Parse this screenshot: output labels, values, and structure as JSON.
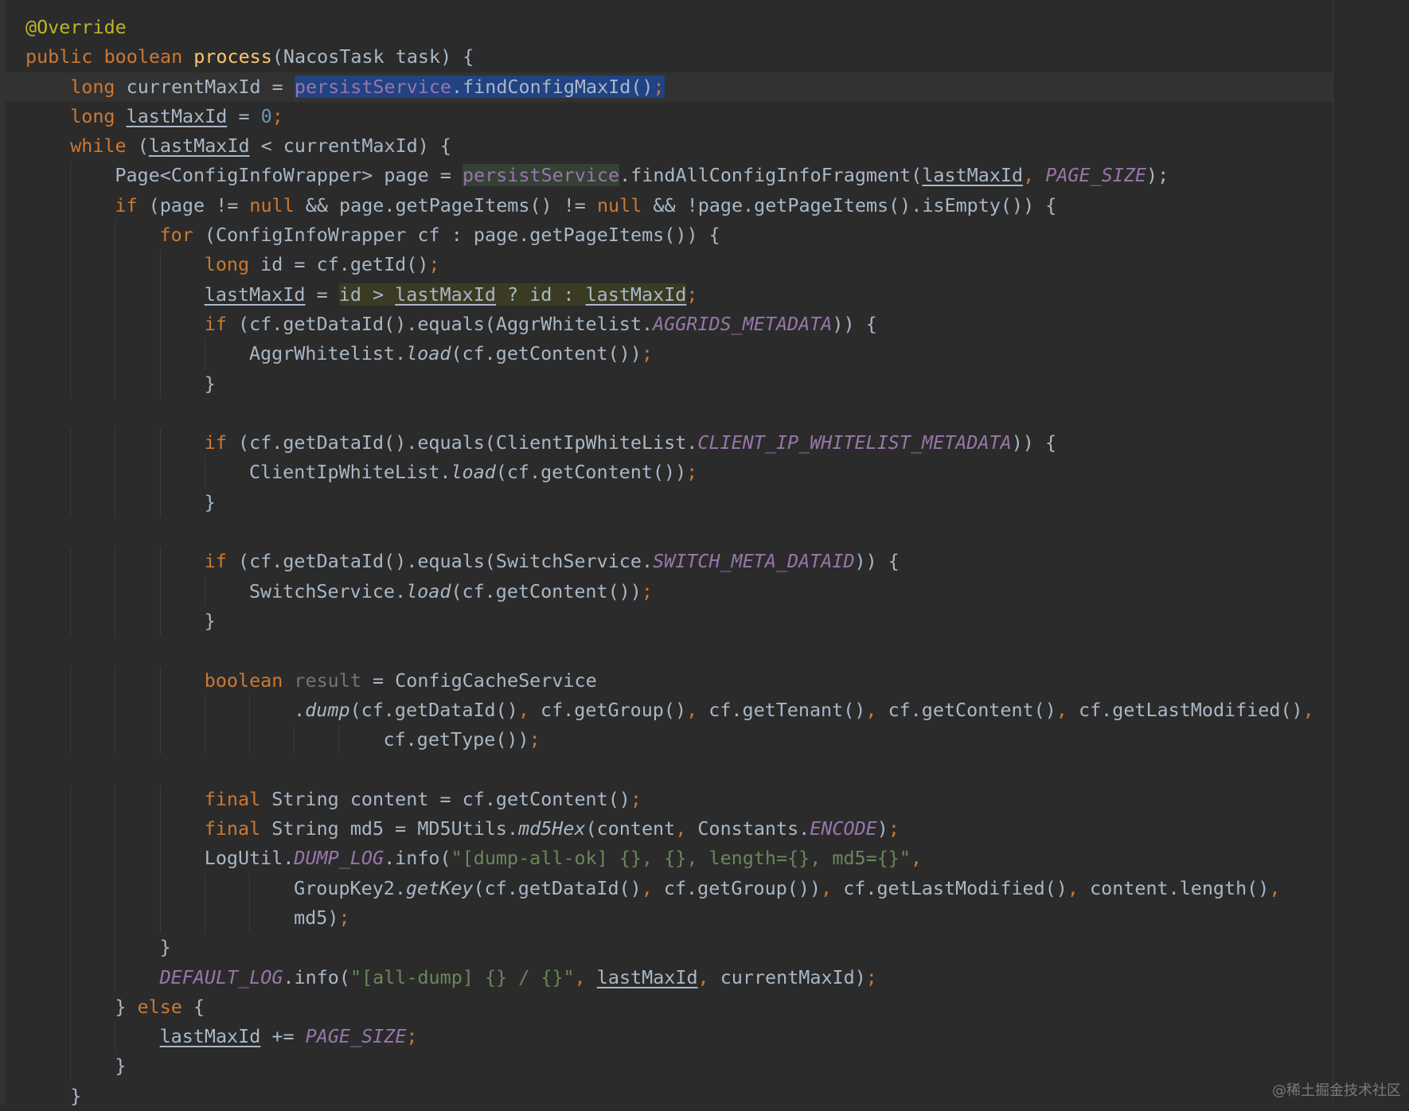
{
  "editor": {
    "colors": {
      "background": "#2b2b2b",
      "keyword": "#cc7832",
      "annotation": "#bbb529",
      "method_declaration": "#ffc66d",
      "number": "#6897bb",
      "string": "#6a8759",
      "constant": "#9876aa",
      "selection": "#214283",
      "default_text": "#a9b7c6"
    },
    "lines": [
      [
        {
          "t": "@Override",
          "c": "ann"
        }
      ],
      [
        {
          "t": "public ",
          "c": "kw"
        },
        {
          "t": "boolean ",
          "c": "kw"
        },
        {
          "t": "process",
          "c": "fn"
        },
        {
          "t": "(NacosTask task) {"
        }
      ],
      [
        {
          "t": "long ",
          "c": "kw"
        },
        {
          "t": "currentMaxId = "
        },
        {
          "t": "persistService",
          "c": "field sel"
        },
        {
          "t": ".findConfigMaxId()",
          "c": "sel"
        },
        {
          "t": ";",
          "c": "kw sel"
        }
      ],
      [
        {
          "t": "long ",
          "c": "kw"
        },
        {
          "t": "lastMaxId",
          "c": "ul"
        },
        {
          "t": " = "
        },
        {
          "t": "0",
          "c": "num"
        },
        {
          "t": ";",
          "c": "kw"
        }
      ],
      [
        {
          "t": "while ",
          "c": "kw"
        },
        {
          "t": "("
        },
        {
          "t": "lastMaxId",
          "c": "ul"
        },
        {
          "t": " < currentMaxId) {"
        }
      ],
      [
        {
          "t": "Page<ConfigInfoWrapper> page = "
        },
        {
          "t": "persistService",
          "c": "field hl-field"
        },
        {
          "t": ".findAllConfigInfoFragment("
        },
        {
          "t": "lastMaxId",
          "c": "ul"
        },
        {
          "t": ", ",
          "c": "kw"
        },
        {
          "t": "PAGE_SIZE",
          "c": "const"
        },
        {
          "t": ");"
        }
      ],
      [
        {
          "t": "if ",
          "c": "kw"
        },
        {
          "t": "(page != "
        },
        {
          "t": "null ",
          "c": "kw"
        },
        {
          "t": "&& page.getPageItems() != "
        },
        {
          "t": "null ",
          "c": "kw"
        },
        {
          "t": "&& !page.getPageItems().isEmpty()) {"
        }
      ],
      [
        {
          "t": "for ",
          "c": "kw"
        },
        {
          "t": "(ConfigInfoWrapper cf : page.getPageItems()) {"
        }
      ],
      [
        {
          "t": "long ",
          "c": "kw"
        },
        {
          "t": "id = cf.getId()"
        },
        {
          "t": ";",
          "c": "kw"
        }
      ],
      [
        {
          "t": "lastMaxId",
          "c": "ul"
        },
        {
          "t": " = "
        },
        {
          "t": "id > ",
          "c": "hl-cond"
        },
        {
          "t": "lastMaxId",
          "c": "ul hl-cond"
        },
        {
          "t": " ? id : ",
          "c": "hl-cond"
        },
        {
          "t": "lastMaxId",
          "c": "ul hl-cond"
        },
        {
          "t": ";",
          "c": "kw"
        }
      ],
      [
        {
          "t": "if ",
          "c": "kw"
        },
        {
          "t": "(cf.getDataId().equals(AggrWhitelist."
        },
        {
          "t": "AGGRIDS_METADATA",
          "c": "const"
        },
        {
          "t": ")) {"
        }
      ],
      [
        {
          "t": "AggrWhitelist."
        },
        {
          "t": "load",
          "c": "stat"
        },
        {
          "t": "(cf.getContent())"
        },
        {
          "t": ";",
          "c": "kw"
        }
      ],
      [
        {
          "t": "}"
        }
      ],
      [],
      [
        {
          "t": "if ",
          "c": "kw"
        },
        {
          "t": "(cf.getDataId().equals(ClientIpWhiteList."
        },
        {
          "t": "CLIENT_IP_WHITELIST_METADATA",
          "c": "const"
        },
        {
          "t": ")) {"
        }
      ],
      [
        {
          "t": "ClientIpWhiteList."
        },
        {
          "t": "load",
          "c": "stat"
        },
        {
          "t": "(cf.getContent())"
        },
        {
          "t": ";",
          "c": "kw"
        }
      ],
      [
        {
          "t": "}"
        }
      ],
      [],
      [
        {
          "t": "if ",
          "c": "kw"
        },
        {
          "t": "(cf.getDataId().equals(SwitchService."
        },
        {
          "t": "SWITCH_META_DATAID",
          "c": "const"
        },
        {
          "t": ")) {"
        }
      ],
      [
        {
          "t": "SwitchService."
        },
        {
          "t": "load",
          "c": "stat"
        },
        {
          "t": "(cf.getContent())"
        },
        {
          "t": ";",
          "c": "kw"
        }
      ],
      [
        {
          "t": "}"
        }
      ],
      [],
      [
        {
          "t": "boolean ",
          "c": "kw"
        },
        {
          "t": "result",
          "c": "unused"
        },
        {
          "t": " = ConfigCacheService"
        }
      ],
      [
        {
          "t": "."
        },
        {
          "t": "dump",
          "c": "stat"
        },
        {
          "t": "(cf.getDataId()"
        },
        {
          "t": ", ",
          "c": "kw"
        },
        {
          "t": "cf.getGroup()"
        },
        {
          "t": ", ",
          "c": "kw"
        },
        {
          "t": "cf.getTenant()"
        },
        {
          "t": ", ",
          "c": "kw"
        },
        {
          "t": "cf.getContent()"
        },
        {
          "t": ", ",
          "c": "kw"
        },
        {
          "t": "cf.getLastModified()"
        },
        {
          "t": ",",
          "c": "kw"
        }
      ],
      [
        {
          "t": "cf.getType())"
        },
        {
          "t": ";",
          "c": "kw"
        }
      ],
      [],
      [
        {
          "t": "final ",
          "c": "kw"
        },
        {
          "t": "String content = cf.getContent()"
        },
        {
          "t": ";",
          "c": "kw"
        }
      ],
      [
        {
          "t": "final ",
          "c": "kw"
        },
        {
          "t": "String md5 = MD5Utils."
        },
        {
          "t": "md5Hex",
          "c": "stat"
        },
        {
          "t": "(content"
        },
        {
          "t": ", ",
          "c": "kw"
        },
        {
          "t": "Constants."
        },
        {
          "t": "ENCODE",
          "c": "const"
        },
        {
          "t": ")"
        },
        {
          "t": ";",
          "c": "kw"
        }
      ],
      [
        {
          "t": "LogUtil."
        },
        {
          "t": "DUMP_LOG",
          "c": "const"
        },
        {
          "t": ".info("
        },
        {
          "t": "\"[dump-all-ok] {}, {}, length={}, md5={}\"",
          "c": "str"
        },
        {
          "t": ",",
          "c": "kw"
        }
      ],
      [
        {
          "t": "GroupKey2."
        },
        {
          "t": "getKey",
          "c": "stat"
        },
        {
          "t": "(cf.getDataId()"
        },
        {
          "t": ", ",
          "c": "kw"
        },
        {
          "t": "cf.getGroup())"
        },
        {
          "t": ", ",
          "c": "kw"
        },
        {
          "t": "cf.getLastModified()"
        },
        {
          "t": ", ",
          "c": "kw"
        },
        {
          "t": "content.length()"
        },
        {
          "t": ",",
          "c": "kw"
        }
      ],
      [
        {
          "t": "md5)"
        },
        {
          "t": ";",
          "c": "kw"
        }
      ],
      [
        {
          "t": "}"
        }
      ],
      [
        {
          "t": "DEFAULT_LOG",
          "c": "const"
        },
        {
          "t": ".info("
        },
        {
          "t": "\"[all-dump] {} / {}\"",
          "c": "str"
        },
        {
          "t": ", ",
          "c": "kw"
        },
        {
          "t": "lastMaxId",
          "c": "ul"
        },
        {
          "t": ", ",
          "c": "kw"
        },
        {
          "t": "currentMaxId)"
        },
        {
          "t": ";",
          "c": "kw"
        }
      ],
      [
        {
          "t": "} "
        },
        {
          "t": "else ",
          "c": "kw"
        },
        {
          "t": "{"
        }
      ],
      [
        {
          "t": "lastMaxId",
          "c": "ul"
        },
        {
          "t": " += "
        },
        {
          "t": "PAGE_SIZE",
          "c": "const"
        },
        {
          "t": ";",
          "c": "kw"
        }
      ],
      [
        {
          "t": "}"
        }
      ],
      [
        {
          "t": "}"
        }
      ]
    ]
  },
  "watermark": "@稀土掘金技术社区"
}
